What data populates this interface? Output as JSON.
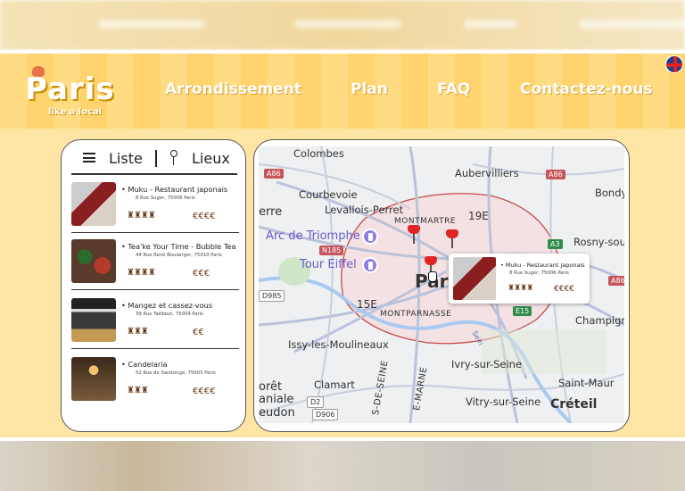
{
  "header": {
    "logo_text": "Paris",
    "logo_tagline": "like a local",
    "nav": [
      {
        "label": "Arrondissement"
      },
      {
        "label": "Plan"
      },
      {
        "label": "FAQ"
      },
      {
        "label": "Contactez-nous"
      }
    ],
    "language_flag": "uk-flag-icon"
  },
  "list_panel": {
    "tabs": {
      "list_label": "Liste",
      "places_label": "Lieux"
    },
    "items": [
      {
        "name": "• Muku - Restaurant japonais",
        "address": "8 Rue Suger, 75006 Paris",
        "rating": "♜♜♜♜",
        "price": "€€€€"
      },
      {
        "name": "• Tea'ke Your Time - Bubble Tea",
        "address": "44 Rue René Boulanger, 75010 Paris",
        "rating": "♜♜♜♜",
        "price": "€€€"
      },
      {
        "name": "• Mangez et cassez-vous",
        "address": "39 Rue Taitbout, 75009 Paris",
        "rating": "♜♜♜",
        "price": "€€"
      },
      {
        "name": "• Candelaria",
        "address": "52 Rue de Saintonge, 75003 Paris",
        "rating": "♜♜♜",
        "price": "€€€€"
      }
    ]
  },
  "map": {
    "labels": {
      "colombes": "Colombes",
      "aubervilliers": "Aubervilliers",
      "courbevoie": "Courbevoie",
      "levallois": "Levallois-Perret",
      "bondy": "Bondy",
      "erre": "erre",
      "montmartre": "MONTMARTRE",
      "e19": "19E",
      "arc": "Arc de Triomphe",
      "rosny": "Rosny-sous",
      "eiffel": "Tour Eiffel",
      "par": "Par",
      "e15": "15E",
      "montparnasse": "MONTPARNASSE",
      "champigny": "Champigny",
      "issy": "Issy-les-Moulineaux",
      "ivry": "Ivry-sur-Seine",
      "clamart": "Clamart",
      "saintmaur": "Saint-Maur",
      "vitry": "Vitry-sur-Seine",
      "oret": "orêt",
      "aniale": "aniale",
      "eudon": "eudon",
      "creteil": "Créteil",
      "seine": "S-DE-SEINE",
      "marne": "E-MARNE",
      "sein2": "Sein"
    },
    "roads": {
      "a86a": "A86",
      "a86b": "A86",
      "a86c": "A86",
      "n185": "N185",
      "a3": "A3",
      "d985": "D985",
      "e15": "E15",
      "d2": "D2",
      "d906": "D906"
    },
    "popup": {
      "name": "• Muku - Restaurant japonais",
      "address": "8 Rue Suger, 75006 Paris",
      "rating": "♜♜♜♜",
      "price": "€€€€"
    }
  },
  "colors": {
    "header_bg": "#ffd46e",
    "main_bg": "#ffe5a3",
    "pin": "#e02424",
    "price": "#6b3a1a",
    "paris_boundary": "#c94a4a"
  }
}
